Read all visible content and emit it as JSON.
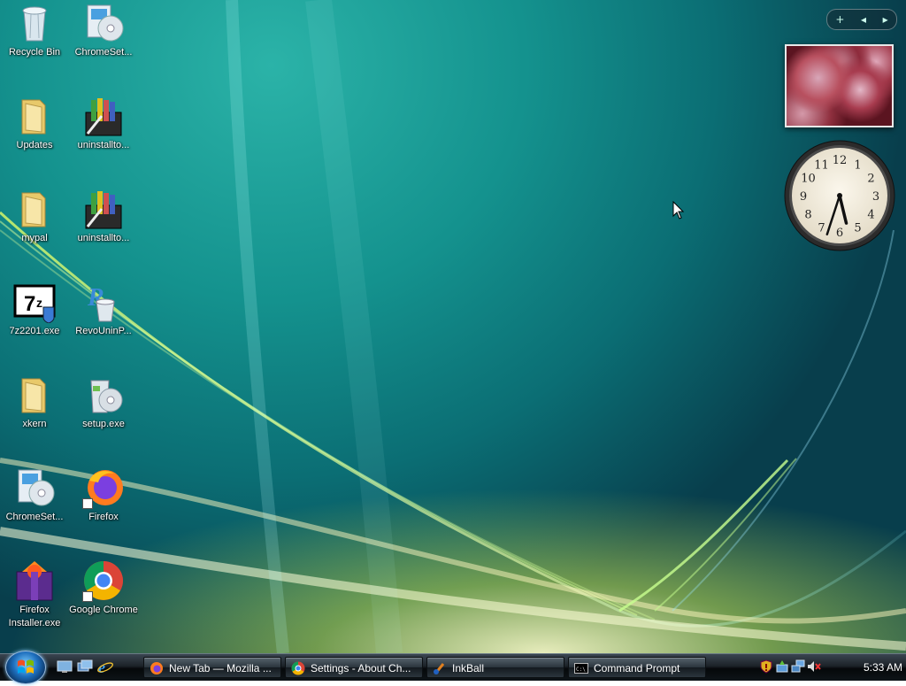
{
  "desktop": {
    "icons": [
      {
        "label": "Recycle Bin",
        "icon": "recycle-bin-icon"
      },
      {
        "label": "ChromeSet...",
        "icon": "installer-cd-icon"
      },
      {
        "label": "Updates",
        "icon": "folder-icon"
      },
      {
        "label": "uninstallto...",
        "icon": "archive-installer-icon"
      },
      {
        "label": "mypal",
        "icon": "folder-icon"
      },
      {
        "label": "uninstallto...",
        "icon": "archive-installer-icon"
      },
      {
        "label": "7z2201.exe",
        "icon": "7zip-installer-icon"
      },
      {
        "label": "RevoUninP...",
        "icon": "revo-uninstaller-icon"
      },
      {
        "label": "xkern",
        "icon": "folder-icon"
      },
      {
        "label": "setup.exe",
        "icon": "setup-cd-icon"
      },
      {
        "label": "ChromeSet...",
        "icon": "installer-cd-icon"
      },
      {
        "label": "Firefox",
        "icon": "firefox-icon"
      },
      {
        "label": "Firefox Installer.exe",
        "icon": "firefox-installer-icon"
      },
      {
        "label": "Google Chrome",
        "icon": "chrome-icon"
      }
    ]
  },
  "sidebar": {
    "controls": {
      "add": "+",
      "prev": "◂",
      "next": "▸"
    },
    "clock": {
      "numerals": [
        "12",
        "1",
        "2",
        "3",
        "4",
        "5",
        "6",
        "7",
        "8",
        "9",
        "10",
        "11"
      ],
      "hour": 5,
      "minute": 33
    },
    "photo": {
      "icon": "slideshow-photo"
    }
  },
  "taskbar": {
    "start_icon": "windows-start-orb-icon",
    "quick_launch": [
      "show-desktop-icon",
      "switch-windows-icon",
      "internet-explorer-icon"
    ],
    "tasks": [
      {
        "label": "New Tab — Mozilla ...",
        "icon": "firefox-icon"
      },
      {
        "label": "Settings - About Ch...",
        "icon": "chrome-icon"
      },
      {
        "label": "InkBall",
        "icon": "inkball-icon"
      },
      {
        "label": "Command Prompt",
        "icon": "command-prompt-icon"
      }
    ],
    "tray": {
      "icons": [
        "security-shield-icon",
        "safely-remove-hardware-icon",
        "network-icon",
        "volume-muted-icon"
      ],
      "time": "5:33 AM"
    }
  },
  "colors": {
    "accent": "#1d6ebd",
    "desktop": "#0b6e74"
  }
}
